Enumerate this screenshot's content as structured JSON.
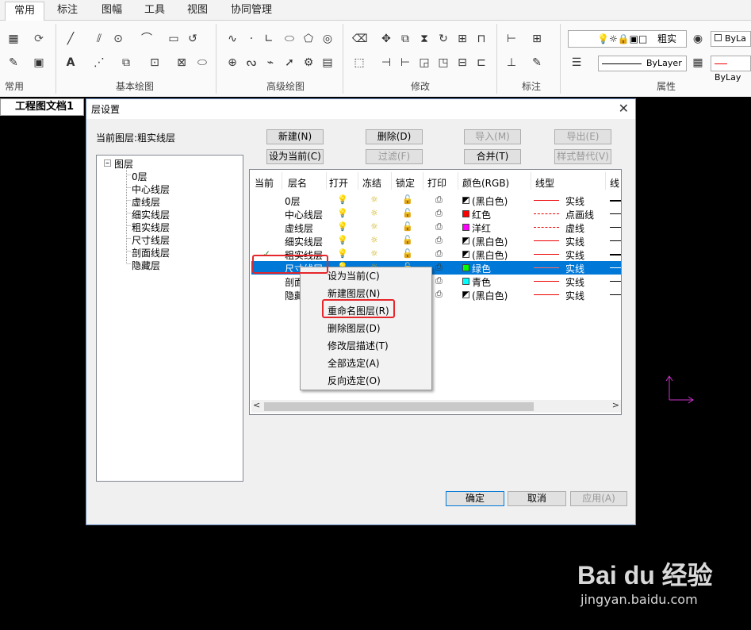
{
  "ribbon": {
    "tabs": [
      "常用",
      "标注",
      "图幅",
      "工具",
      "视图",
      "协同管理"
    ],
    "panels": [
      "常用",
      "基本绘图",
      "高级绘图",
      "修改",
      "标注",
      "属性"
    ],
    "layer_combo": "粗实",
    "color_combo": "ByLa",
    "linetype_combo": "ByLayer",
    "lineweight_combo": "ByLay"
  },
  "document": {
    "tab": "工程图文档1"
  },
  "dialog": {
    "title": "层设置",
    "current_layer": "当前图层:粗实线层",
    "buttons": {
      "new": "新建(N)",
      "delete": "删除(D)",
      "import": "导入(M)",
      "export": "导出(E)",
      "set_current": "设为当前(C)",
      "filter": "过滤(F)",
      "merge": "合并(T)",
      "style_override": "样式替代(V)",
      "ok": "确定",
      "cancel": "取消",
      "apply": "应用(A)"
    },
    "tree": {
      "root": "图层",
      "nodes": [
        "0层",
        "中心线层",
        "虚线层",
        "细实线层",
        "粗实线层",
        "尺寸线层",
        "剖面线层",
        "隐藏层"
      ]
    },
    "grid": {
      "headers": [
        "当前",
        "层名",
        "打开",
        "冻结",
        "锁定",
        "打印",
        "颜色(RGB)",
        "线型",
        "线"
      ],
      "rows": [
        {
          "current": "",
          "name": "0层",
          "color": "(黑白色)",
          "linetype": "实线"
        },
        {
          "current": "",
          "name": "中心线层",
          "color": "红色",
          "linetype": "点画线"
        },
        {
          "current": "",
          "name": "虚线层",
          "color": "洋红",
          "linetype": "虚线"
        },
        {
          "current": "",
          "name": "细实线层",
          "color": "(黑白色)",
          "linetype": "实线"
        },
        {
          "current": "✓",
          "name": "粗实线层",
          "color": "(黑白色)",
          "linetype": "实线"
        },
        {
          "current": "",
          "name": "尺寸线层",
          "color": "绿色",
          "linetype": "实线"
        },
        {
          "current": "",
          "name": "剖面线层",
          "color": "青色",
          "linetype": "实线"
        },
        {
          "current": "",
          "name": "隐藏层",
          "color": "(黑白色)",
          "linetype": "实线"
        }
      ],
      "selected_row": 5
    },
    "context_menu": [
      "设为当前(C)",
      "新建图层(N)",
      "重命名图层(R)",
      "删除图层(D)",
      "修改层描述(T)",
      "全部选定(A)",
      "反向选定(O)"
    ]
  },
  "colors": {
    "black_white": "#000000",
    "red": "#ff0000",
    "magenta": "#ff00ff",
    "green": "#00ff00",
    "cyan": "#00ffff",
    "selection": "#0078d7",
    "highlight_box": "#e5262b",
    "ucs_icon": "#cc33cc"
  },
  "watermark": {
    "text": "Bai du 经验",
    "url": "jingyan.baidu.com"
  }
}
